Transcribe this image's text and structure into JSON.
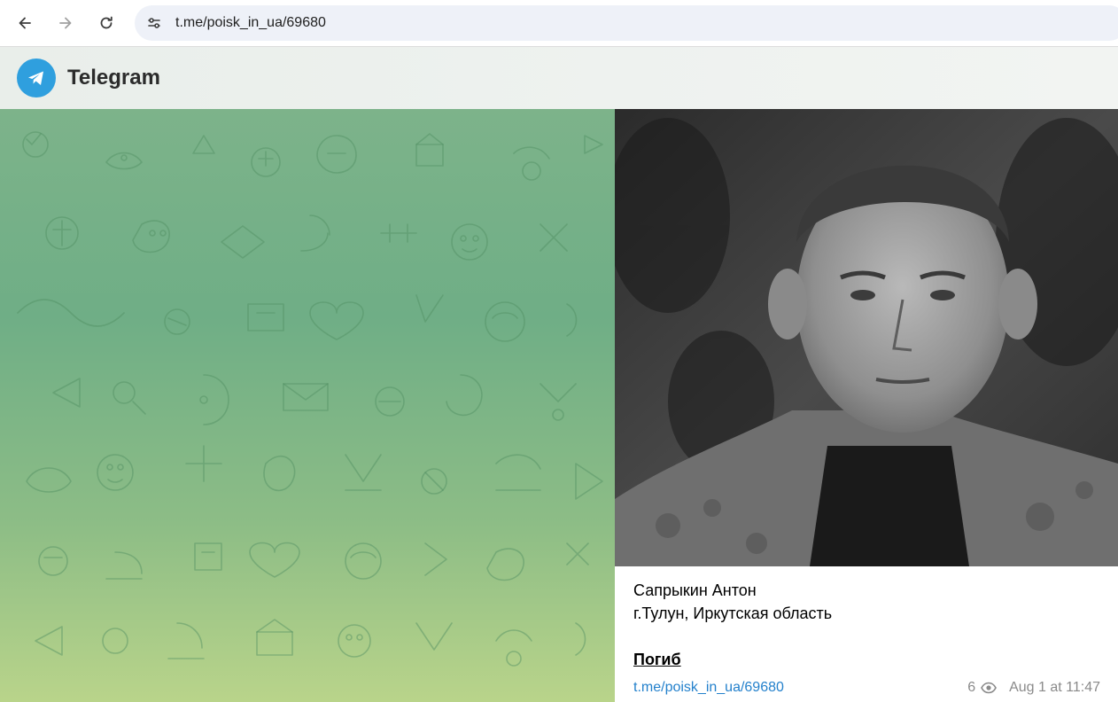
{
  "browser": {
    "url": "t.me/poisk_in_ua/69680",
    "back_icon": "arrow-left-icon",
    "forward_icon": "arrow-right-icon",
    "reload_icon": "reload-icon",
    "site_info_icon": "tune-icon"
  },
  "header": {
    "title": "Telegram",
    "logo_icon": "telegram-plane-icon",
    "logo_color": "#2f9fde"
  },
  "post": {
    "name": "Сапрыкин Антон",
    "place": "г.Тулун, Иркутская область",
    "status": "Погиб",
    "link": "t.me/poisk_in_ua/69680",
    "views": "6",
    "views_icon": "eye-icon",
    "time": "Aug 1 at 11:47"
  },
  "colors": {
    "link": "#2481cc",
    "background_top": "#7db38a",
    "background_bottom": "#b9d48a"
  }
}
